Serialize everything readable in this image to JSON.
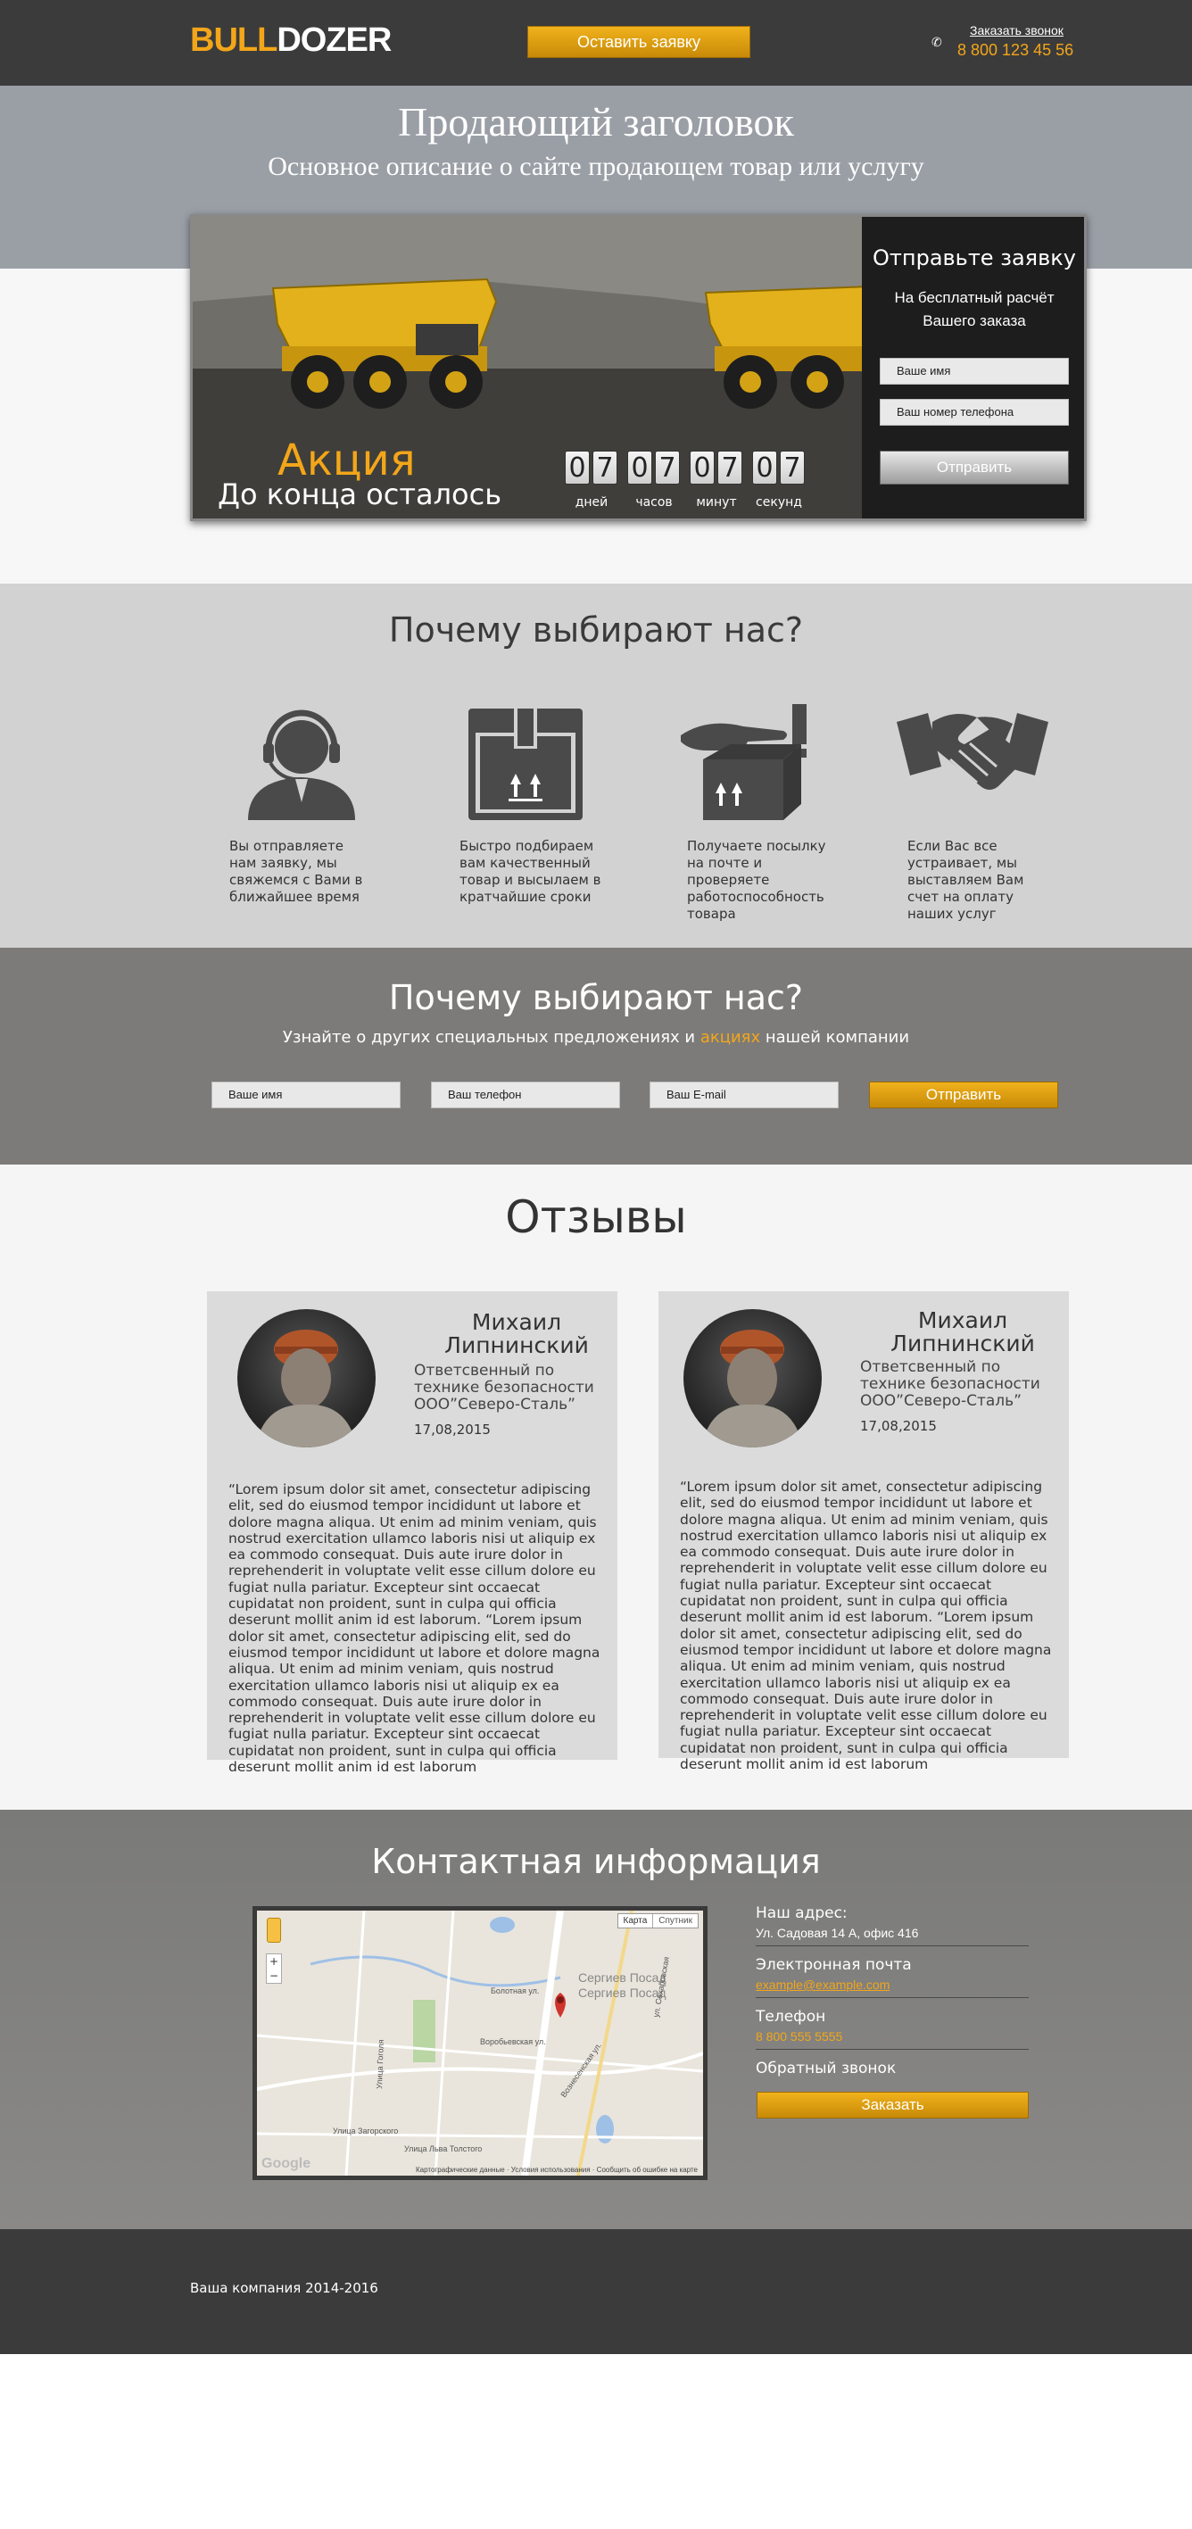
{
  "header": {
    "logo_part1": "BULL",
    "logo_part2": "DOZER",
    "cta_label": "Оставить заявку",
    "callback_link": "Заказать звонок",
    "phone": "8 800 123 45 56",
    "phone_icon": "phone-icon"
  },
  "hero": {
    "title": "Продающий заголовок",
    "subtitle": "Основное описание о сайте продающем товар или услугу",
    "promo": "Акция",
    "promo_until": "До конца осталось",
    "timer": {
      "days": "07",
      "hours": "07",
      "minutes": "07",
      "seconds": "07",
      "labels": [
        "дней",
        "часов",
        "минут",
        "секунд"
      ]
    },
    "form": {
      "title": "Отправьте заявку",
      "subtitle_line1": "На бесплатный расчёт",
      "subtitle_line2": "Вашего заказа",
      "name_placeholder": "Ваше имя",
      "phone_placeholder": "Ваш номер телефона",
      "submit_label": "Отправить"
    }
  },
  "why": {
    "title": "Почему выбирают нас?",
    "features": [
      {
        "icon": "operator-headset-icon",
        "text": "Вы отправляете нам заявку, мы свяжемся с Вами в ближайшее время"
      },
      {
        "icon": "box-icon",
        "text": "Быстро подбираем вам качественный товар и высылаем в кратчайшие сроки"
      },
      {
        "icon": "hand-package-icon",
        "text": "Получаете посылку на почте и проверяете работоспособность товара"
      },
      {
        "icon": "handshake-icon",
        "text": "Если Вас все устраивает, мы выставляем Вам счет на оплату наших услуг"
      }
    ]
  },
  "subscribe": {
    "title": "Почему выбирают нас?",
    "text_before": "Узнайте о других специальных предложениях и ",
    "text_highlight": "акциях",
    "text_after": " нашей компании",
    "name_placeholder": "Ваше имя",
    "phone_placeholder": "Ваш телефон",
    "email_placeholder": "Ваш E-mail",
    "submit_label": "Отправить"
  },
  "reviews": {
    "title": "Отзывы",
    "items": [
      {
        "name": "Михаил Липнинский",
        "position": "Ответсвенный по технике безопасности ООО”Северо-Сталь”",
        "date": "17,08,2015",
        "text": "“Lorem ipsum dolor sit amet, consectetur adipiscing elit, sed do eiusmod tempor incididunt ut labore et dolore magna aliqua. Ut enim ad minim veniam, quis nostrud exercitation ullamco laboris nisi ut aliquip ex ea commodo consequat. Duis aute irure dolor in reprehenderit in voluptate velit esse cillum dolore eu fugiat nulla pariatur. Excepteur sint occaecat cupidatat non proident, sunt in culpa qui officia deserunt mollit anim id est laborum. “Lorem ipsum dolor sit amet, consectetur adipiscing elit, sed do eiusmod tempor incididunt ut labore et dolore magna aliqua. Ut enim ad minim veniam, quis nostrud exercitation ullamco laboris nisi ut aliquip ex ea commodo consequat. Duis aute irure dolor in reprehenderit in voluptate velit esse cillum dolore eu fugiat nulla pariatur. Excepteur sint occaecat cupidatat non proident, sunt in culpa qui officia deserunt mollit anim id est laborum"
      },
      {
        "name": "Михаил Липнинский",
        "position": "Ответсвенный по технике безопасности ООО”Северо-Сталь”",
        "date": "17,08,2015",
        "text": "“Lorem ipsum dolor sit amet, consectetur adipiscing elit, sed do eiusmod tempor incididunt ut labore et dolore magna aliqua. Ut enim ad minim veniam, quis nostrud exercitation ullamco laboris nisi ut aliquip ex ea commodo consequat. Duis aute irure dolor in reprehenderit in voluptate velit esse cillum dolore eu fugiat nulla pariatur. Excepteur sint occaecat cupidatat non proident, sunt in culpa qui officia deserunt mollit anim id est laborum. “Lorem ipsum dolor sit amet, consectetur adipiscing elit, sed do eiusmod tempor incididunt ut labore et dolore magna aliqua. Ut enim ad minim veniam, quis nostrud exercitation ullamco laboris nisi ut aliquip ex ea commodo consequat. Duis aute irure dolor in reprehenderit in voluptate velit esse cillum dolore eu fugiat nulla pariatur. Excepteur sint occaecat cupidatat non proident, sunt in culpa qui officia deserunt mollit anim id est laborum"
      }
    ]
  },
  "contacts": {
    "title": "Контактная информация",
    "map": {
      "tab_map": "Карта",
      "tab_satellite": "Спутник",
      "zoom_in": "+",
      "zoom_out": "−",
      "logo": "Google",
      "footer": "Картографические данные · Условия использования · Сообщить об ошибке на карте",
      "place_labels": [
        "Сергиев Посад",
        "Сергиев Посад",
        "Болотная ул.",
        "Воробьевская ул.",
        "Вознесенская ул.",
        "Улица Загорского",
        "Улица Льва Толстого",
        "ул. Сахаровская",
        "Улица Гоголя"
      ]
    },
    "address_label": "Наш адрес:",
    "address": "Ул. Садовая 14 А, офис 416",
    "email_label": "Электронная почта",
    "email": "example@example.com",
    "phone_label": "Телефон",
    "phone": "8 800 555 5555",
    "callback_label": "Обратный звонок",
    "callback_button": "Заказать"
  },
  "footer": {
    "copyright": "Ваша компания 2014-2016"
  },
  "colors": {
    "accent": "#f3a619",
    "header_bg": "#3b3b3b",
    "hero_band": "#9a9fa6",
    "why_bg": "#d2d2d2",
    "subscribe_bg": "#7c7b79"
  }
}
